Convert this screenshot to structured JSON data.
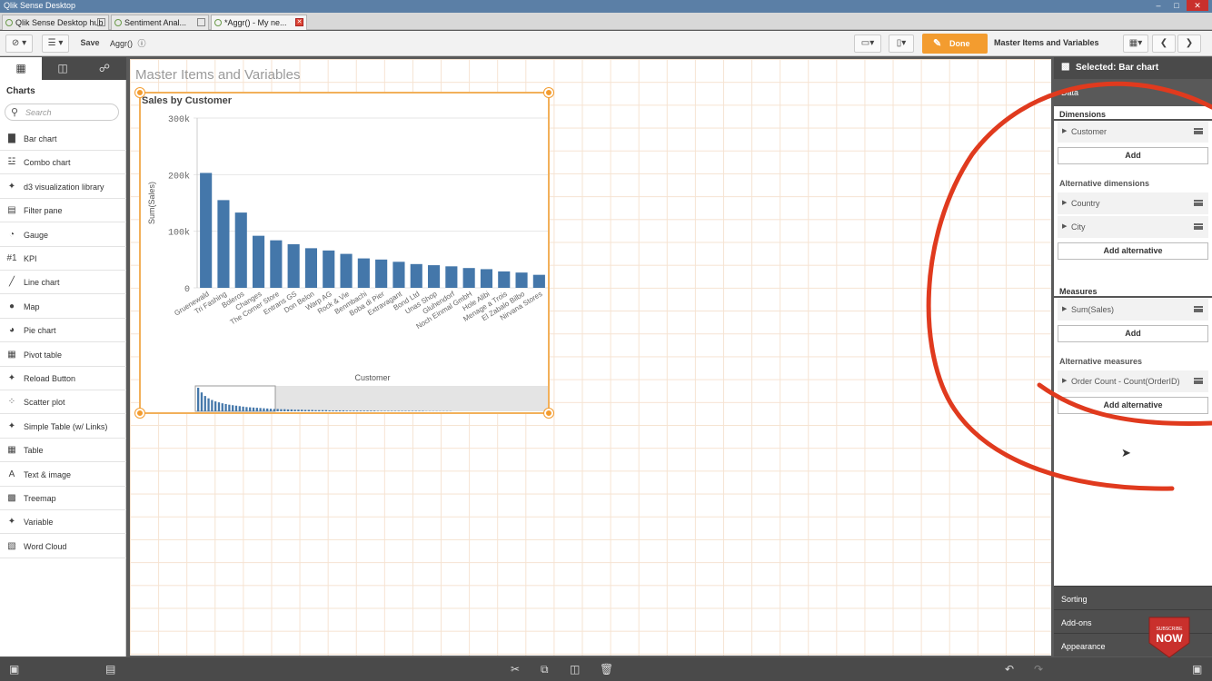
{
  "window": {
    "title": "Qlik Sense Desktop"
  },
  "tabs": [
    {
      "label": "Qlik Sense Desktop hub"
    },
    {
      "label": "Sentiment Anal..."
    },
    {
      "label": "*Aggr() - My ne..."
    }
  ],
  "toolbar": {
    "save_label": "Save",
    "app_name": "Aggr()",
    "done_label": "Done",
    "sheet_name": "Master Items and Variables"
  },
  "left_panel": {
    "heading": "Charts",
    "search_placeholder": "Search",
    "items": [
      {
        "label": "Bar chart",
        "icon": "bar-chart-icon"
      },
      {
        "label": "Combo chart",
        "icon": "combo-chart-icon"
      },
      {
        "label": "d3 visualization library",
        "icon": "extension-icon"
      },
      {
        "label": "Filter pane",
        "icon": "filter-pane-icon"
      },
      {
        "label": "Gauge",
        "icon": "gauge-icon"
      },
      {
        "label": "KPI",
        "icon": "kpi-icon"
      },
      {
        "label": "Line chart",
        "icon": "line-chart-icon"
      },
      {
        "label": "Map",
        "icon": "map-icon"
      },
      {
        "label": "Pie chart",
        "icon": "pie-chart-icon"
      },
      {
        "label": "Pivot table",
        "icon": "pivot-table-icon"
      },
      {
        "label": "Reload Button",
        "icon": "extension-icon"
      },
      {
        "label": "Scatter plot",
        "icon": "scatter-plot-icon"
      },
      {
        "label": "Simple Table (w/ Links)",
        "icon": "extension-icon"
      },
      {
        "label": "Table",
        "icon": "table-icon"
      },
      {
        "label": "Text & image",
        "icon": "text-image-icon"
      },
      {
        "label": "Treemap",
        "icon": "treemap-icon"
      },
      {
        "label": "Variable",
        "icon": "extension-icon"
      },
      {
        "label": "Word Cloud",
        "icon": "word-cloud-icon"
      }
    ]
  },
  "canvas": {
    "sheet_title": "Master Items and Variables"
  },
  "chart_data": {
    "type": "bar",
    "title": "Sales by Customer",
    "xlabel": "Customer",
    "ylabel": "Sum(Sales)",
    "ylim": [
      0,
      300000
    ],
    "yticks": [
      "0",
      "100k",
      "200k",
      "300k"
    ],
    "categories": [
      "Gruenewald",
      "Tri Fashing",
      "Boleros",
      "Changes",
      "The Corner Store",
      "Entrans GS",
      "Don Belon",
      "Warp AG",
      "Rock & Vie",
      "Benmbachi",
      "Boba di Pier",
      "Extravagant",
      "Bond Ltd",
      "Unas Shop",
      "Gluhendorf",
      "Noch Einmal GmbH",
      "Hole Alibi",
      "Menage a Trois",
      "El Zabalo Bilbo",
      "Nirvana Stores"
    ],
    "values": [
      203000,
      155000,
      133000,
      92000,
      84000,
      77000,
      70000,
      66000,
      60000,
      52000,
      50000,
      46000,
      42000,
      40000,
      38000,
      35000,
      33000,
      29000,
      27000,
      23000
    ],
    "minichart_values": [
      100,
      80,
      65,
      55,
      48,
      42,
      38,
      34,
      31,
      28,
      26,
      24,
      22,
      20,
      18,
      17,
      16,
      15,
      14,
      13,
      12,
      11,
      10,
      10,
      9,
      9,
      8,
      8,
      7,
      7,
      7,
      6,
      6,
      6,
      5,
      5,
      5,
      5,
      4,
      4,
      4,
      4,
      4,
      3,
      3,
      3,
      3,
      3,
      3,
      3,
      3,
      3,
      2,
      2,
      2,
      2,
      2,
      2,
      2,
      2,
      2,
      2,
      2,
      2,
      2,
      2,
      1,
      1,
      1,
      1,
      1,
      1,
      1,
      1
    ],
    "bar_color": "#4477aa"
  },
  "right_panel": {
    "header": "Selected: Bar chart",
    "data_tab": "Data",
    "dimensions_label": "Dimensions",
    "dimension": "Customer",
    "add_label": "Add",
    "alt_dimensions_label": "Alternative dimensions",
    "alt_dimensions": [
      "Country",
      "City"
    ],
    "add_alternative_label": "Add alternative",
    "measures_label": "Measures",
    "measure": "Sum(Sales)",
    "alt_measures_label": "Alternative measures",
    "alt_measure": "Order Count - Count(OrderID)",
    "sorting_label": "Sorting",
    "addons_label": "Add-ons",
    "appearance_label": "Appearance"
  },
  "badge": {
    "line1": "SUBSCRIBE",
    "line2": "NOW"
  },
  "colors": {
    "accent": "#f39c2f",
    "annotation": "#e03a1e",
    "badge": "#c9302c"
  }
}
